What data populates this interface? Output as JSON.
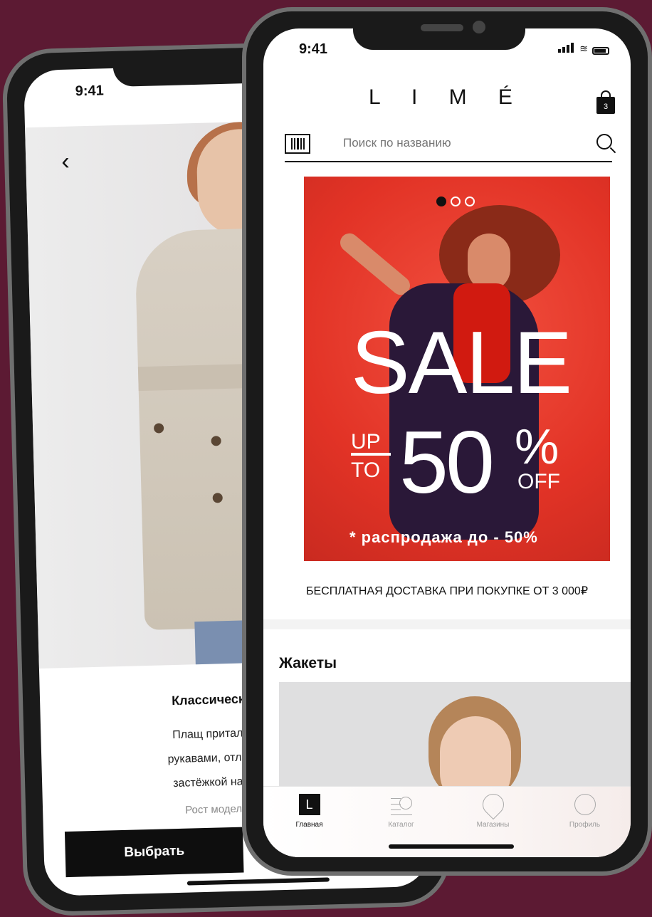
{
  "back_phone": {
    "status_time": "9:41",
    "product": {
      "title": "Классическ",
      "description_lines": [
        "Плащ приталенного си",
        "рукавами, отложным вор",
        "застёжкой на пуговицы"
      ],
      "more": "Рост модели"
    },
    "select_label": "Выбрать"
  },
  "front_phone": {
    "status_time": "9:41",
    "logo": "L I M É",
    "cart_count": "3",
    "search": {
      "placeholder": "Поиск по названию"
    },
    "banner": {
      "sale": "SALE",
      "up": "UP",
      "to": "TO",
      "discount": "50",
      "percent": "%",
      "off": "OFF",
      "note": "* распродажа до - 50%"
    },
    "delivery_text": "БЕСПЛАТНАЯ ДОСТАВКА ПРИ ПОКУПКЕ ОТ 3 000₽",
    "section_title": "Жакеты",
    "tabs": [
      {
        "label": "Главная",
        "icon": "home-icon"
      },
      {
        "label": "Каталог",
        "icon": "catalog-icon"
      },
      {
        "label": "Магазины",
        "icon": "store-icon"
      },
      {
        "label": "Профиль",
        "icon": "profile-icon"
      }
    ]
  }
}
